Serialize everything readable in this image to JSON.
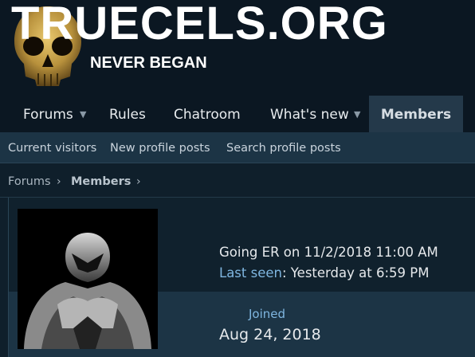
{
  "site": {
    "title": "TRUECELS.ORG",
    "tagline": "NEVER BEGAN"
  },
  "nav": {
    "items": [
      {
        "label": "Forums"
      },
      {
        "label": "Rules"
      },
      {
        "label": "Chatroom"
      },
      {
        "label": "What's new"
      },
      {
        "label": "Members"
      }
    ],
    "caret_icon": "chevron-down-icon"
  },
  "subnav": {
    "items": [
      {
        "label": "Current visitors"
      },
      {
        "label": "New profile posts"
      },
      {
        "label": "Search profile posts"
      }
    ]
  },
  "breadcrumb": {
    "items": [
      {
        "label": "Forums"
      },
      {
        "label": "Members"
      }
    ],
    "separator_icon": "chevron-right-icon"
  },
  "profile": {
    "status": "Going ER on 11/2/2018 11:00 AM",
    "last_seen_label": "Last seen",
    "last_seen_value": "Yesterday at 6:59 PM",
    "joined_label": "Joined",
    "joined_value": "Aug 24, 2018"
  },
  "colors": {
    "header_bg": "#0b1722",
    "active_tab_bg": "#24394a",
    "subnav_bg": "#1c3445",
    "link": "#7fb6e0",
    "skull": "#d4b25a"
  }
}
